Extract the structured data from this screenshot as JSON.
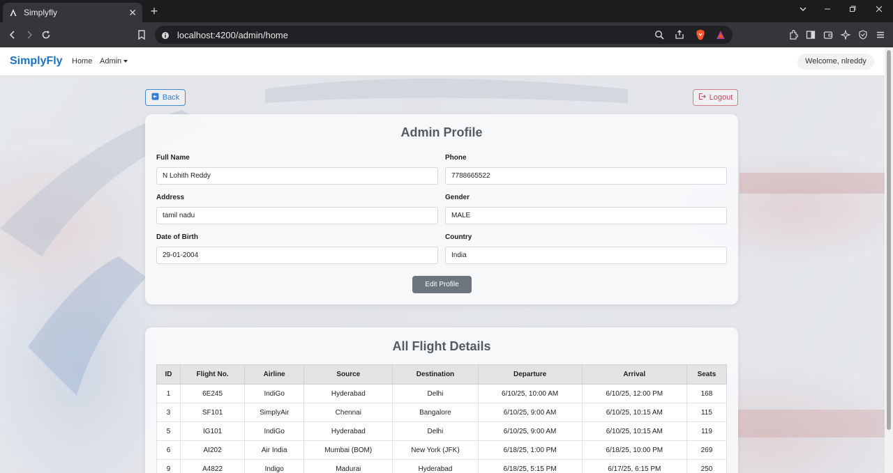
{
  "browser": {
    "tab_title": "Simplyfly",
    "url": "localhost:4200/admin/home"
  },
  "navbar": {
    "brand": "SimplyFly",
    "home": "Home",
    "admin": "Admin",
    "welcome": "Welcome, nlreddy"
  },
  "actions": {
    "back": "Back",
    "logout": "Logout"
  },
  "profile": {
    "title": "Admin Profile",
    "fields": [
      {
        "label": "Full Name",
        "value": "N Lohith Reddy"
      },
      {
        "label": "Phone",
        "value": "7788665522"
      },
      {
        "label": "Address",
        "value": "tamil nadu"
      },
      {
        "label": "Gender",
        "value": "MALE"
      },
      {
        "label": "Date of Birth",
        "value": "29-01-2004"
      },
      {
        "label": "Country",
        "value": "India"
      }
    ],
    "edit_button": "Edit Profile"
  },
  "flights": {
    "title": "All Flight Details",
    "columns": [
      "ID",
      "Flight No.",
      "Airline",
      "Source",
      "Destination",
      "Departure",
      "Arrival",
      "Seats"
    ],
    "rows": [
      [
        "1",
        "6E245",
        "IndiGo",
        "Hyderabad",
        "Delhi",
        "6/10/25, 10:00 AM",
        "6/10/25, 12:00 PM",
        "168"
      ],
      [
        "3",
        "SF101",
        "SimplyAir",
        "Chennai",
        "Bangalore",
        "6/10/25, 9:00 AM",
        "6/10/25, 10:15 AM",
        "115"
      ],
      [
        "5",
        "IG101",
        "IndiGo",
        "Hyderabad",
        "Delhi",
        "6/10/25, 9:00 AM",
        "6/10/25, 10:15 AM",
        "119"
      ],
      [
        "6",
        "AI202",
        "Air India",
        "Mumbai (BOM)",
        "New York (JFK)",
        "6/18/25, 1:00 PM",
        "6/18/25, 10:00 PM",
        "269"
      ],
      [
        "9",
        "A4822",
        "Indigo",
        "Madurai",
        "Hyderabad",
        "6/18/25, 5:15 PM",
        "6/17/25, 6:15 PM",
        "250"
      ]
    ]
  },
  "colors": {
    "brand": "#1a73c9",
    "back": "#2c7fd0",
    "logout": "#c9485c",
    "edit": "#6c757d"
  }
}
